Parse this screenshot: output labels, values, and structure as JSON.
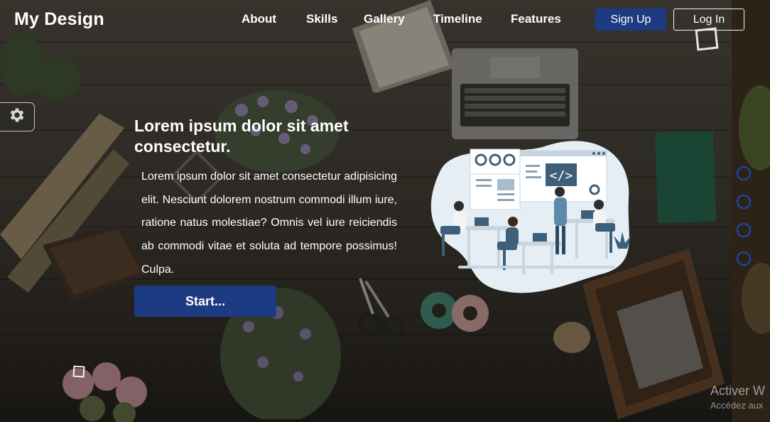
{
  "nav": {
    "brand": "My Design",
    "links": [
      "About",
      "Skills",
      "Gallery",
      "Timeline",
      "Features"
    ],
    "signup_label": "Sign Up",
    "login_label": "Log In"
  },
  "hero": {
    "title": "Lorem ipsum dolor sit amet consectetur.",
    "paragraph": "Lorem ipsum dolor sit amet consectetur adipisicing elit. Nesciunt dolorem nostrum commodi illum iure, ratione natus molestiae? Omnis vel iure reiciendis ab commodi vitae et soluta ad tempore possimus! Culpa.",
    "start_label": "Start...",
    "illustration_code_tag": "</>"
  },
  "bullets": {
    "count": 4,
    "color": "#1d48b4"
  },
  "watermark": {
    "line1": "Activer W",
    "line2": "Accédez aux"
  },
  "icons": {
    "settings": "gear-icon"
  },
  "colors": {
    "primary_button": "#1d3b82",
    "text": "#ffffff"
  }
}
